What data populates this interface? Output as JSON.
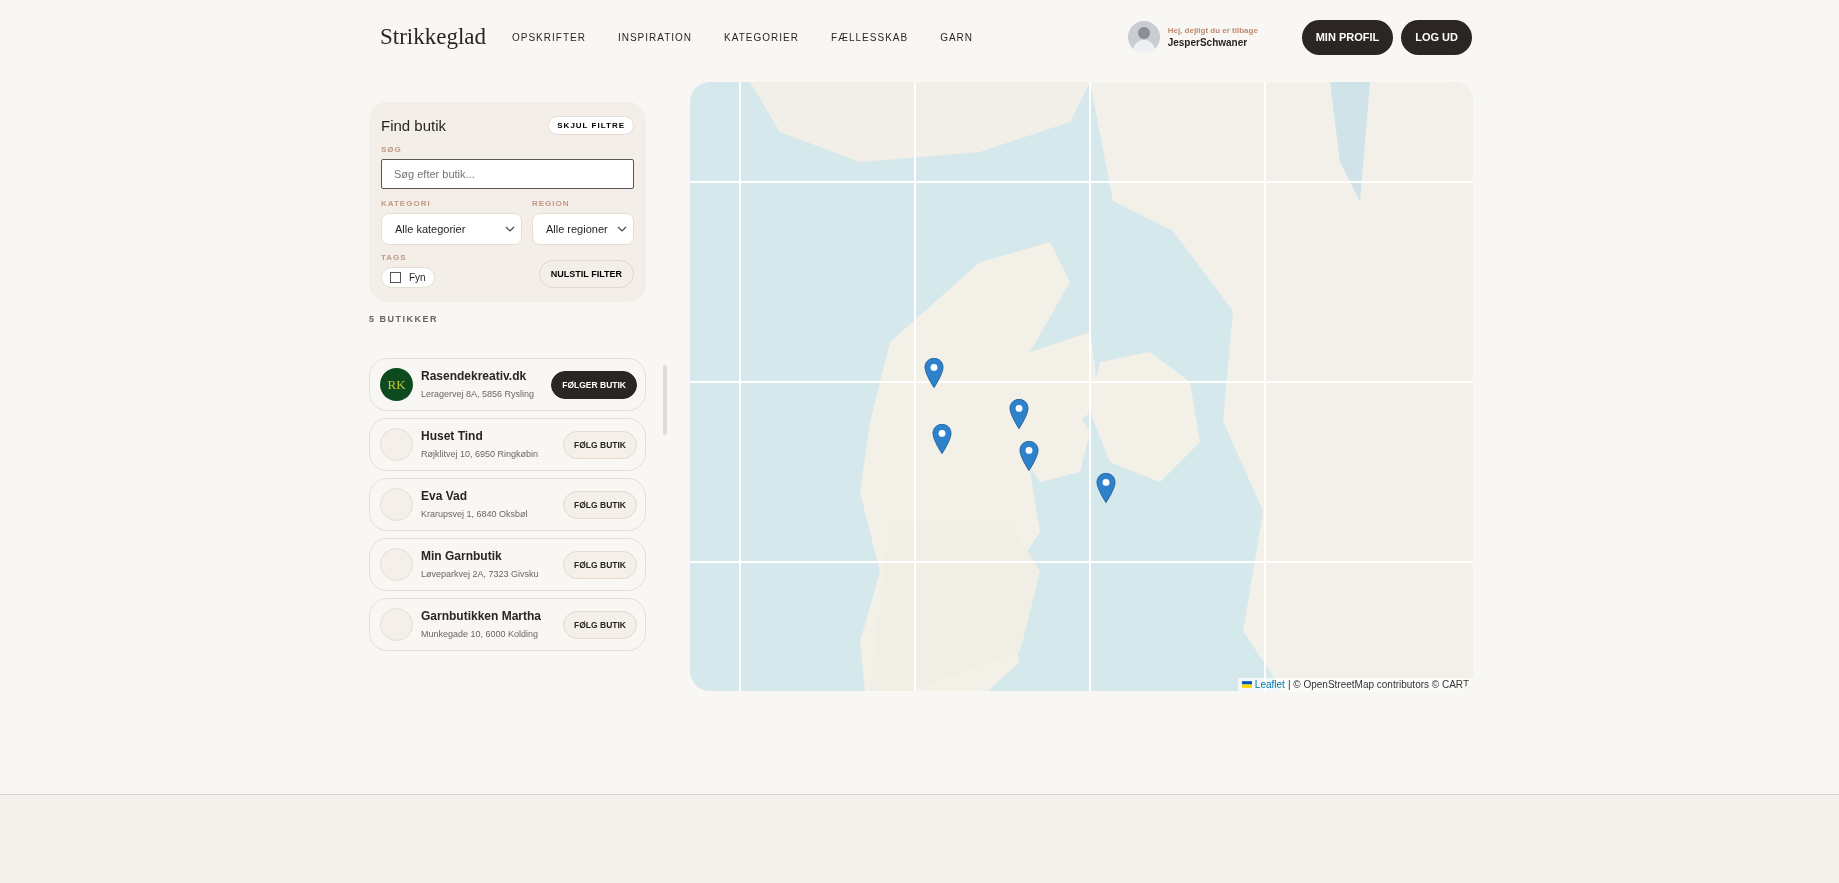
{
  "header": {
    "logo": "Strikkeglad",
    "nav": [
      {
        "label": "OPSKRIFTER"
      },
      {
        "label": "INSPIRATION"
      },
      {
        "label": "KATEGORIER"
      },
      {
        "label": "FÆLLESSKAB"
      },
      {
        "label": "GARN"
      }
    ],
    "greeting": "Hej, dejligt du er tilbage",
    "username": "JesperSchwaner",
    "buttons": [
      "MIN PROFIL",
      "LOG UD"
    ]
  },
  "filters": {
    "title": "Find butik",
    "toggle": "SKJUL FILTRE",
    "search_label": "SØG",
    "search": {
      "placeholder": "Søg efter butik..."
    },
    "category_label": "KATEGORI",
    "category": "Alle kategorier",
    "region_label": "REGION",
    "region": "Alle regioner",
    "tags_label": "TAGS",
    "tags": [
      {
        "label": "Fyn",
        "checked": false
      }
    ],
    "reset": "NULSTIL FILTER"
  },
  "count": "5 BUTIKKER",
  "stores": [
    {
      "name": "Rasendekreativ.dk",
      "address": "Leragervej 8A, 5856 Rysling",
      "logo_text": "RK",
      "following": true,
      "button": "FØLGER BUTIK"
    },
    {
      "name": "Huset Tind",
      "address": "Røjklitvej 10, 6950 Ringkøbin",
      "following": false,
      "button": "FØLG BUTIK"
    },
    {
      "name": "Eva Vad",
      "address": "Krarupsvej 1, 6840 Oksbøl",
      "following": false,
      "button": "FØLG BUTIK"
    },
    {
      "name": "Min Garnbutik",
      "address": "Løveparkvej 2A, 7323 Givsku",
      "following": false,
      "button": "FØLG BUTIK"
    },
    {
      "name": "Garnbutikken Martha",
      "address": "Munkegade 10, 6000 Kolding",
      "following": false,
      "button": "FØLG BUTIK"
    }
  ],
  "map": {
    "attribution_link": "Leaflet",
    "attribution": "| © OpenStreetMap contributors © CART"
  }
}
